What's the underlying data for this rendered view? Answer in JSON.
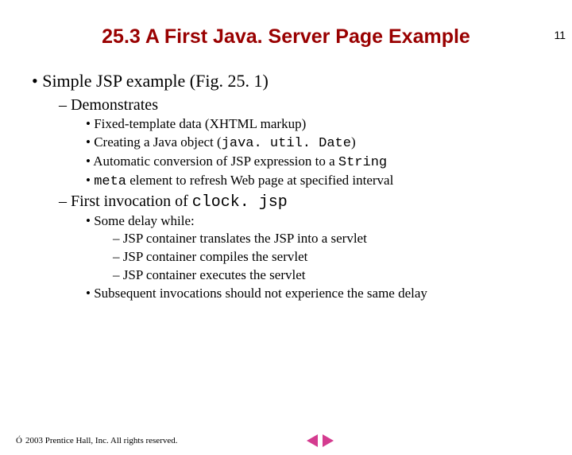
{
  "page_number": "11",
  "title": "25.3   A First Java. Server Page Example",
  "bullets": {
    "l1_0_pre": "Simple JSP example (Fig. 25. 1)",
    "l2_0": "Demonstrates",
    "l3_0": "Fixed-template data (XHTML markup)",
    "l3_1_pre": "Creating a Java object (",
    "l3_1_code": "java. util. Date",
    "l3_1_post": ")",
    "l3_2_pre": "Automatic conversion of JSP expression to a ",
    "l3_2_code": "String",
    "l3_3_code": "meta",
    "l3_3_post": " element to refresh Web page at specified interval",
    "l2_1_pre": "First invocation of ",
    "l2_1_code": "clock. jsp",
    "l3_4": "Some delay while:",
    "l4_0": "JSP container translates the JSP into a servlet",
    "l4_1": "JSP container compiles the servlet",
    "l4_2": "JSP container executes the servlet",
    "l3_5": "Subsequent invocations should not experience the same delay"
  },
  "footer": {
    "symbol": "Ó",
    "text": " 2003 Prentice Hall, Inc. All rights reserved."
  }
}
